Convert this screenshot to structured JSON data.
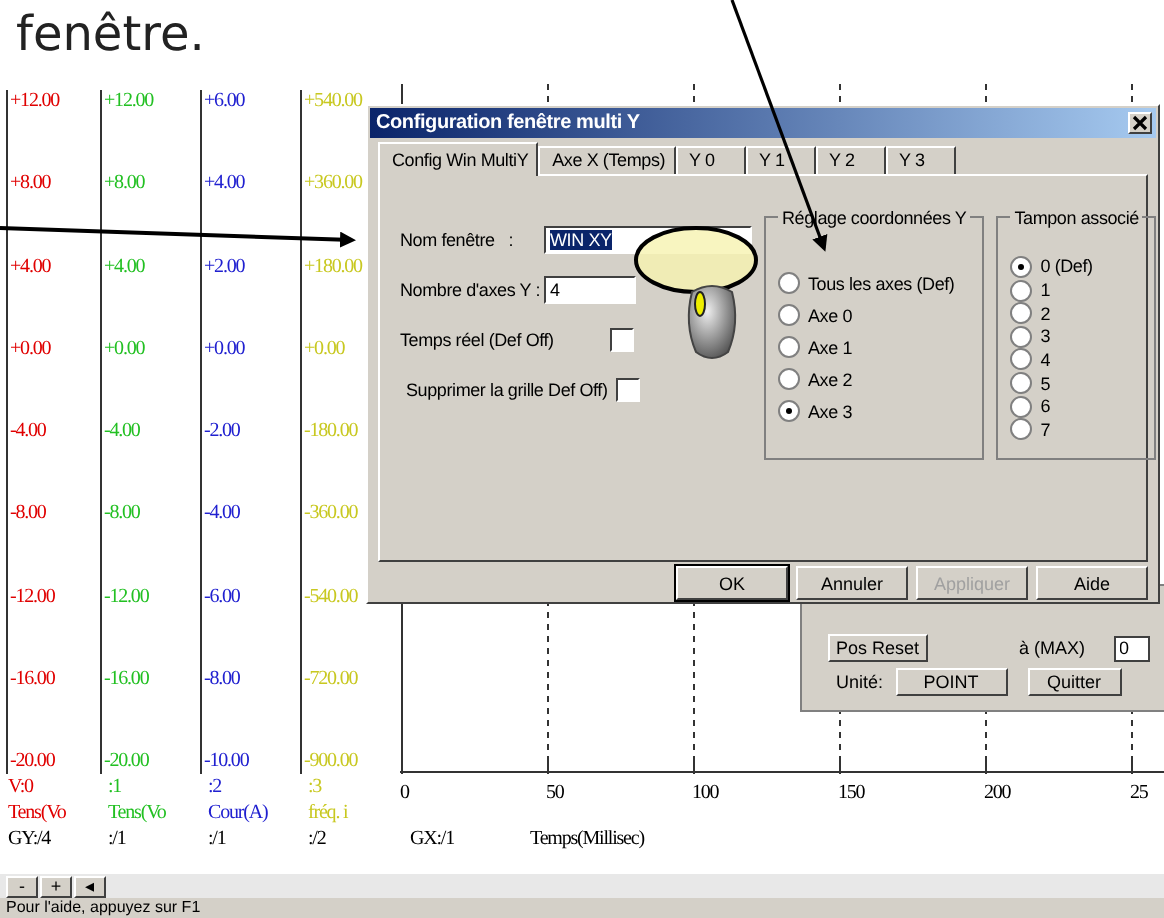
{
  "annotation": {
    "caption": "fenêtre."
  },
  "axes": [
    {
      "color": "#e00000",
      "labels": [
        "+12.00",
        "+8.00",
        "+4.00",
        "+0.00",
        "-4.00",
        "-8.00",
        "-12.00",
        "-16.00",
        "-20.00"
      ],
      "index": "V:0",
      "name": "Tens(Vo",
      "scale": "GY:/4"
    },
    {
      "color": "#22c022",
      "labels": [
        "+12.00",
        "+8.00",
        "+4.00",
        "+0.00",
        "-4.00",
        "-8.00",
        "-12.00",
        "-16.00",
        "-20.00"
      ],
      "index": ":1",
      "name": "Tens(Vo",
      "scale": ":/1"
    },
    {
      "color": "#2020d0",
      "labels": [
        "+6.00",
        "+4.00",
        "+2.00",
        "+0.00",
        "-2.00",
        "-4.00",
        "-6.00",
        "-8.00",
        "-10.00"
      ],
      "index": ":2",
      "name": "Cour(A)",
      "scale": ":/1"
    },
    {
      "color": "#c8c820",
      "labels": [
        "+540.00",
        "+360.00",
        "+180.00",
        "+0.00",
        "-180.00",
        "-360.00",
        "-540.00",
        "-720.00",
        "-900.00"
      ],
      "index": ":3",
      "name": "fréq. i",
      "scale": ":/2"
    }
  ],
  "plot": {
    "xticks": [
      "0",
      "50",
      "100",
      "150",
      "200",
      "25"
    ],
    "scale": "GX:/1",
    "xlabel": "Temps(Millisec)"
  },
  "scroll_buttons": [
    "-",
    "+",
    "◂"
  ],
  "status_bar": "Pour l'aide, appuyez sur F1",
  "back_panel": {
    "reset_button": "Pos Reset",
    "max_label": "à (MAX)",
    "max_value": "0",
    "unit_label": "Unité:",
    "unit_button": "POINT",
    "quit_button": "Quitter"
  },
  "dialog": {
    "title": "Configuration fenêtre multi Y",
    "tabs": [
      {
        "label": "Config Win MultiY",
        "selected": true
      },
      {
        "label": "Axe X (Temps)",
        "selected": false
      },
      {
        "label": "Y 0",
        "selected": false
      },
      {
        "label": "Y 1",
        "selected": false
      },
      {
        "label": "Y 2",
        "selected": false
      },
      {
        "label": "Y 3",
        "selected": false
      }
    ],
    "name_label": "Nom fenêtre   :",
    "name_value": "WIN XY",
    "axes_label": "Nombre d'axes Y :",
    "axes_value": "4",
    "checkboxes": [
      {
        "label": "Temps réel (Def Off)",
        "checked": false
      },
      {
        "label": "Supprimer la grille Def Off)",
        "checked": false
      }
    ],
    "coord_group": {
      "title": "Réglage coordonnées Y",
      "options": [
        {
          "label": "Tous les axes (Def)",
          "selected": false
        },
        {
          "label": "Axe 0",
          "selected": false
        },
        {
          "label": "Axe 1",
          "selected": false
        },
        {
          "label": "Axe 2",
          "selected": false
        },
        {
          "label": "Axe 3",
          "selected": true
        }
      ]
    },
    "buffer_group": {
      "title": "Tampon associé",
      "options": [
        {
          "label": "0 (Def)",
          "selected": true
        },
        {
          "label": "1",
          "selected": false
        },
        {
          "label": "2",
          "selected": false
        },
        {
          "label": "3",
          "selected": false
        },
        {
          "label": "4",
          "selected": false
        },
        {
          "label": "5",
          "selected": false
        },
        {
          "label": "6",
          "selected": false
        },
        {
          "label": "7",
          "selected": false
        }
      ]
    },
    "buttons": [
      {
        "label": "OK",
        "disabled": false
      },
      {
        "label": "Annuler",
        "disabled": false
      },
      {
        "label": "Appliquer",
        "disabled": true
      },
      {
        "label": "Aide",
        "disabled": false
      }
    ]
  }
}
